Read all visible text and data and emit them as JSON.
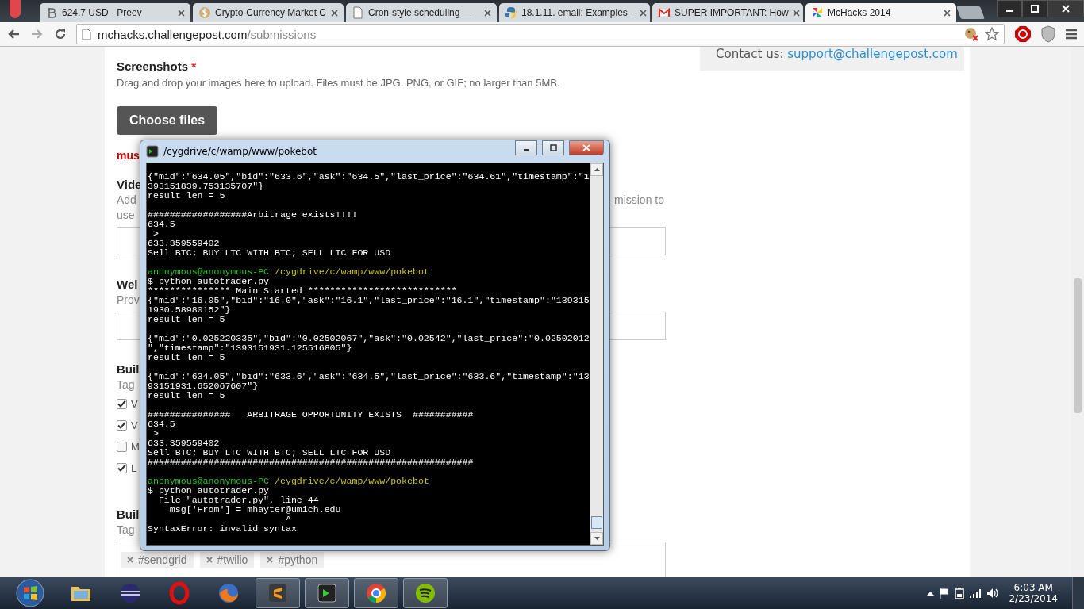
{
  "browser": {
    "tabs": [
      {
        "kind": "bitcoin",
        "title": "624.7 USD · Preev",
        "selected": false
      },
      {
        "kind": "dollar",
        "title": "Crypto-Currency Market C",
        "selected": false
      },
      {
        "kind": "page",
        "title": "Cron-style scheduling —",
        "selected": false
      },
      {
        "kind": "python",
        "title": "18.1.11. email: Examples –",
        "selected": false
      },
      {
        "kind": "mail",
        "title": "SUPER IMPORTANT: How",
        "selected": false
      },
      {
        "kind": "pinwheel",
        "title": "McHacks 2014",
        "selected": true
      }
    ],
    "address": {
      "host": "mchacks.challengepost.com",
      "path": "/submissions"
    }
  },
  "page": {
    "sidebar": {
      "label": "Contact us: ",
      "link": "support@challengepost.com"
    },
    "screenshots": {
      "title": "Screenshots",
      "required": "*",
      "hint": "Drag and drop your images here to upload. Files must be JPG, PNG, or GIF; no larger than 5MB.",
      "button": "Choose files",
      "error": "mus"
    },
    "video": {
      "title": "Vide",
      "hint_left_1": "Add",
      "hint_right_1": "mission to",
      "hint_left_2": "use"
    },
    "website": {
      "title": "Wel",
      "hint": "Prov"
    },
    "built_with": {
      "title": "Buil",
      "hint": "Tag",
      "options": [
        {
          "label": "V",
          "checked": true
        },
        {
          "label": "V",
          "checked": true
        },
        {
          "label": "M",
          "checked": false
        },
        {
          "label": "L",
          "checked": true
        }
      ]
    },
    "built_with_2": {
      "title": "Buil",
      "hint": "Tag",
      "tags": [
        "#sendgrid",
        "#twilio",
        "#python"
      ]
    }
  },
  "terminal": {
    "title": "/cygdrive/c/wamp/www/pokebot",
    "lines": [
      {
        "kind": "out",
        "text": "{\"mid\":\"634.05\",\"bid\":\"633.6\",\"ask\":\"634.5\",\"last_price\":\"634.61\",\"timestamp\":\"1"
      },
      {
        "kind": "out",
        "text": "393151839.753135707\"}"
      },
      {
        "kind": "out",
        "text": "result len = 5"
      },
      {
        "kind": "blank"
      },
      {
        "kind": "out",
        "text": "##################Arbitrage exists!!!!"
      },
      {
        "kind": "out",
        "text": "634.5"
      },
      {
        "kind": "out",
        "text": " >"
      },
      {
        "kind": "out",
        "text": "633.359559402"
      },
      {
        "kind": "out",
        "text": "Sell BTC; BUY LTC WITH BTC; SELL LTC FOR USD"
      },
      {
        "kind": "blank"
      },
      {
        "kind": "prompt",
        "user": "anonymous@anonymous-PC",
        "path": "/cygdrive/c/wamp/www/pokebot"
      },
      {
        "kind": "out",
        "text": "$ python autotrader.py"
      },
      {
        "kind": "out",
        "text": "*************** Main Started ***************************"
      },
      {
        "kind": "out",
        "text": "{\"mid\":\"16.05\",\"bid\":\"16.0\",\"ask\":\"16.1\",\"last_price\":\"16.1\",\"timestamp\":\"139315"
      },
      {
        "kind": "out",
        "text": "1930.58980152\"}"
      },
      {
        "kind": "out",
        "text": "result len = 5"
      },
      {
        "kind": "blank"
      },
      {
        "kind": "out",
        "text": "{\"mid\":\"0.025220335\",\"bid\":\"0.02502067\",\"ask\":\"0.02542\",\"last_price\":\"0.02502012"
      },
      {
        "kind": "out",
        "text": "\",\"timestamp\":\"1393151931.125516805\"}"
      },
      {
        "kind": "out",
        "text": "result len = 5"
      },
      {
        "kind": "blank"
      },
      {
        "kind": "out",
        "text": "{\"mid\":\"634.05\",\"bid\":\"633.6\",\"ask\":\"634.5\",\"last_price\":\"633.6\",\"timestamp\":\"13"
      },
      {
        "kind": "out",
        "text": "93151931.652067607\"}"
      },
      {
        "kind": "out",
        "text": "result len = 5"
      },
      {
        "kind": "blank"
      },
      {
        "kind": "out",
        "text": "###############   ARBITRAGE OPPORTUNITY EXISTS  ###########"
      },
      {
        "kind": "out",
        "text": "634.5"
      },
      {
        "kind": "out",
        "text": " >"
      },
      {
        "kind": "out",
        "text": "633.359559402"
      },
      {
        "kind": "out",
        "text": "Sell BTC; BUY LTC WITH BTC; SELL LTC FOR USD"
      },
      {
        "kind": "out",
        "text": "###########################################################"
      },
      {
        "kind": "blank"
      },
      {
        "kind": "prompt",
        "user": "anonymous@anonymous-PC",
        "path": "/cygdrive/c/wamp/www/pokebot"
      },
      {
        "kind": "out",
        "text": "$ python autotrader.py"
      },
      {
        "kind": "out",
        "text": "  File \"autotrader.py\", line 44"
      },
      {
        "kind": "out",
        "text": "    msg['From'] = mhayter@umich.edu"
      },
      {
        "kind": "out",
        "text": "                         ^"
      },
      {
        "kind": "out",
        "text": "SyntaxError: invalid syntax"
      }
    ]
  },
  "taskbar": {
    "apps": [
      {
        "kind": "folder",
        "running": false
      },
      {
        "kind": "eclipse",
        "running": false
      },
      {
        "kind": "opera",
        "running": false
      },
      {
        "kind": "firefox",
        "running": false
      },
      {
        "kind": "sublime",
        "running": true
      },
      {
        "kind": "terminal",
        "running": true
      },
      {
        "kind": "chrome",
        "running": true
      },
      {
        "kind": "spotify",
        "running": true
      }
    ],
    "time": "6:03 AM",
    "date": "2/23/2014"
  }
}
